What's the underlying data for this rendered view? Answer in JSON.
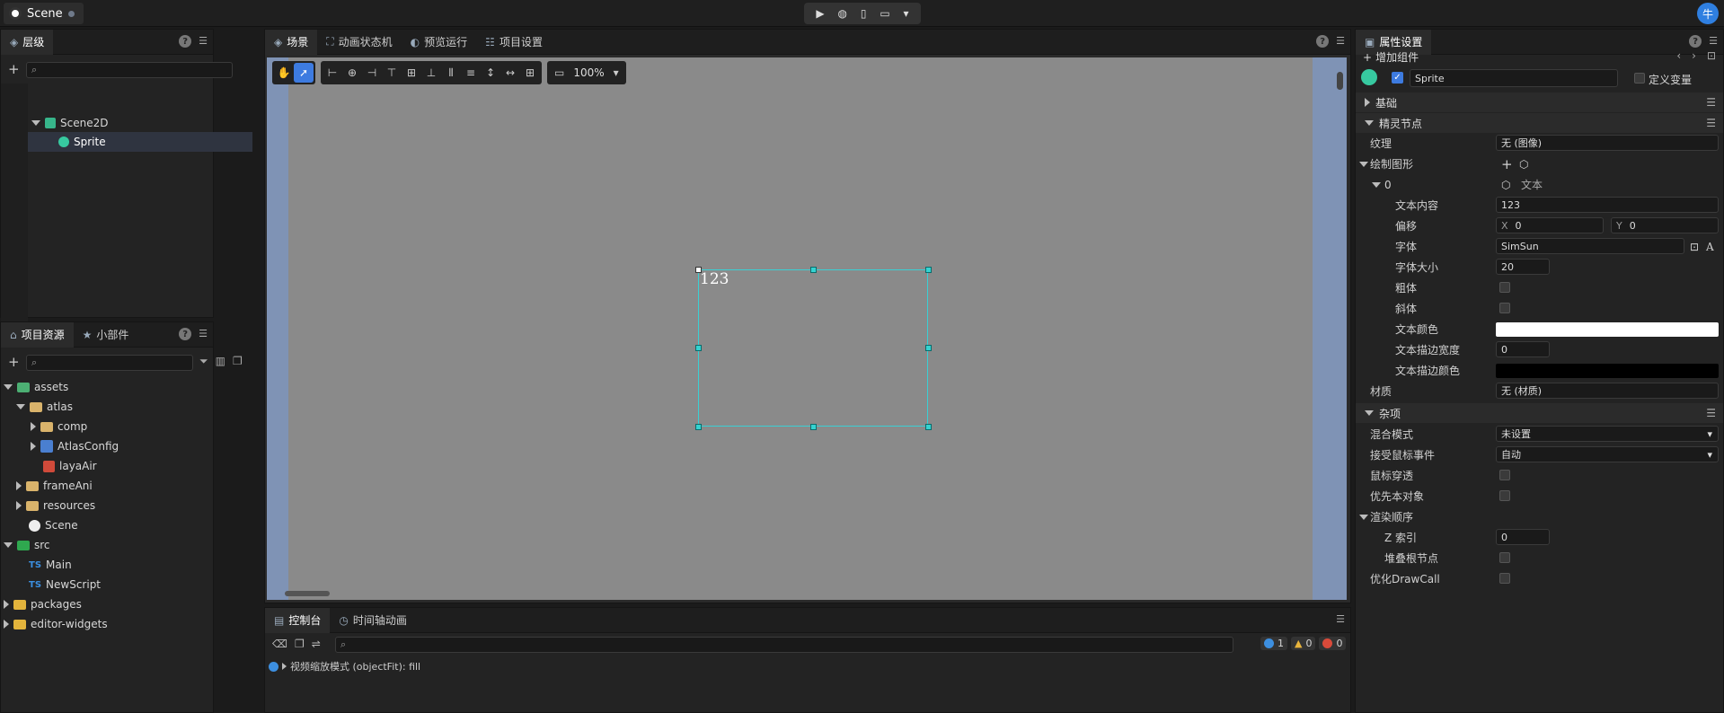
{
  "topbar": {
    "doc_title": "Scene",
    "avatar": "牛",
    "run_icons": [
      "play-icon",
      "globe-icon",
      "phone-icon",
      "monitor-icon",
      "chevron-down-icon"
    ]
  },
  "hierarchy": {
    "tab": "层级",
    "items": [
      {
        "label": "Scene2D"
      },
      {
        "label": "Sprite"
      }
    ]
  },
  "assets": {
    "tabs": [
      "项目资源",
      "小部件"
    ],
    "items": [
      "assets",
      "atlas",
      "comp",
      "AtlasConfig",
      "layaAir",
      "frameAni",
      "resources",
      "Scene",
      "src",
      "Main",
      "NewScript",
      "packages",
      "editor-widgets"
    ],
    "ts_badge": "TS"
  },
  "scene": {
    "tabs": [
      "场景",
      "动画状态机",
      "预览运行",
      "项目设置"
    ],
    "zoom": "100%",
    "sprite_text": "123"
  },
  "console": {
    "tabs": [
      "控制台",
      "时间轴动画"
    ],
    "counts": {
      "info": "1",
      "warn": "0",
      "error": "0"
    },
    "log": "视频缩放模式 (objectFit): fill"
  },
  "inspector": {
    "tab": "属性设置",
    "add_component": "增加组件",
    "name": "Sprite",
    "define_var": "定义变量",
    "sections": {
      "basic": "基础",
      "sprite_node": "精灵节点",
      "misc": "杂项",
      "render_order": "渲染顺序"
    },
    "labels": {
      "texture": "纹理",
      "draw_shapes": "绘制图形",
      "index0": "0",
      "text_kind": "文本",
      "text_content": "文本内容",
      "offset": "偏移",
      "font": "字体",
      "font_size": "字体大小",
      "bold": "粗体",
      "italic": "斜体",
      "text_color": "文本颜色",
      "stroke_width": "文本描边宽度",
      "stroke_color": "文本描边颜色",
      "material": "材质",
      "blend_mode": "混合模式",
      "mouse_events": "接受鼠标事件",
      "mouse_through": "鼠标穿透",
      "priority_obj": "优先本对象",
      "z_index": "Z 索引",
      "stack_root": "堆叠根节点",
      "optimize_dc": "优化DrawCall"
    },
    "values": {
      "texture": "无 (图像)",
      "text_content": "123",
      "offset_x_label": "X",
      "offset_x": "0",
      "offset_y_label": "Y",
      "offset_y": "0",
      "font": "SimSun",
      "font_size": "20",
      "text_color": "#ffffff",
      "stroke_width": "0",
      "stroke_color": "#000000",
      "material": "无 (材质)",
      "blend_mode": "未设置",
      "mouse_events": "自动",
      "z_index": "0"
    }
  }
}
